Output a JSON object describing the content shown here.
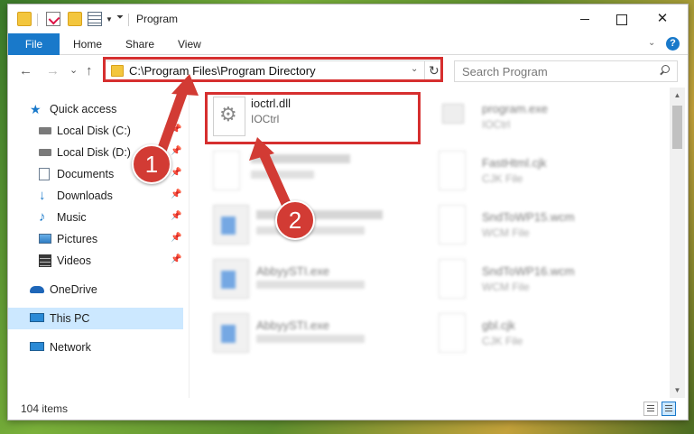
{
  "window": {
    "title": "Program",
    "controls": {
      "minimize": "",
      "maximize": "",
      "close": "✕"
    }
  },
  "ribbon": {
    "tabs": [
      {
        "label": "File"
      },
      {
        "label": "Home"
      },
      {
        "label": "Share"
      },
      {
        "label": "View"
      }
    ],
    "help_label": "?"
  },
  "navigation": {
    "back": "←",
    "forward": "→",
    "recent": "⌄",
    "up": "↑",
    "address": "C:\\Program Files\\Program Directory",
    "refresh": "↻",
    "search_placeholder": "Search Program"
  },
  "sidebar": {
    "items": [
      {
        "label": "Quick access",
        "icon": "star-icon",
        "pinned": false
      },
      {
        "label": "Local Disk (C:)",
        "icon": "drive-icon",
        "pinned": true
      },
      {
        "label": "Local Disk (D:)",
        "icon": "drive-icon",
        "pinned": true
      },
      {
        "label": "Documents",
        "icon": "documents-icon",
        "pinned": true
      },
      {
        "label": "Downloads",
        "icon": "downloads-icon",
        "pinned": true
      },
      {
        "label": "Music",
        "icon": "music-icon",
        "pinned": true
      },
      {
        "label": "Pictures",
        "icon": "pictures-icon",
        "pinned": true
      },
      {
        "label": "Videos",
        "icon": "videos-icon",
        "pinned": true
      },
      {
        "label": "OneDrive",
        "icon": "onedrive-icon",
        "pinned": false
      },
      {
        "label": "This PC",
        "icon": "this-pc-icon",
        "pinned": false,
        "selected": true
      },
      {
        "label": "Network",
        "icon": "network-icon",
        "pinned": false
      }
    ]
  },
  "files": {
    "left": [
      {
        "name": "ioctrl.dll",
        "type": "IOCtrl",
        "icon": "dll-gear-icon",
        "highlighted": true
      },
      {
        "name": "",
        "type": "",
        "icon": "document-icon"
      },
      {
        "name": "",
        "type": "",
        "icon": "installer-icon"
      },
      {
        "name": "AbbyySTI.exe",
        "type": "",
        "icon": "installer-icon"
      },
      {
        "name": "AbbyySTI.exe",
        "type": "",
        "icon": "installer-icon"
      }
    ],
    "right": [
      {
        "name": "program.exe",
        "type": "IOCtrl",
        "icon": "program-icon"
      },
      {
        "name": "FastHtml.cjk",
        "type": "CJK File",
        "icon": "document-icon"
      },
      {
        "name": "SndToWP15.wcm",
        "type": "WCM File",
        "icon": "document-icon"
      },
      {
        "name": "SndToWP16.wcm",
        "type": "WCM File",
        "icon": "document-icon"
      },
      {
        "name": "gbl.cjk",
        "type": "CJK File",
        "icon": "document-icon"
      }
    ]
  },
  "annotations": {
    "callout_1": "1",
    "callout_2": "2",
    "color": "#d23b34"
  },
  "status": {
    "item_count": "104 items"
  },
  "colors": {
    "accent": "#1979ca",
    "selection": "#cce8ff",
    "highlight_box": "#d62f2f"
  }
}
